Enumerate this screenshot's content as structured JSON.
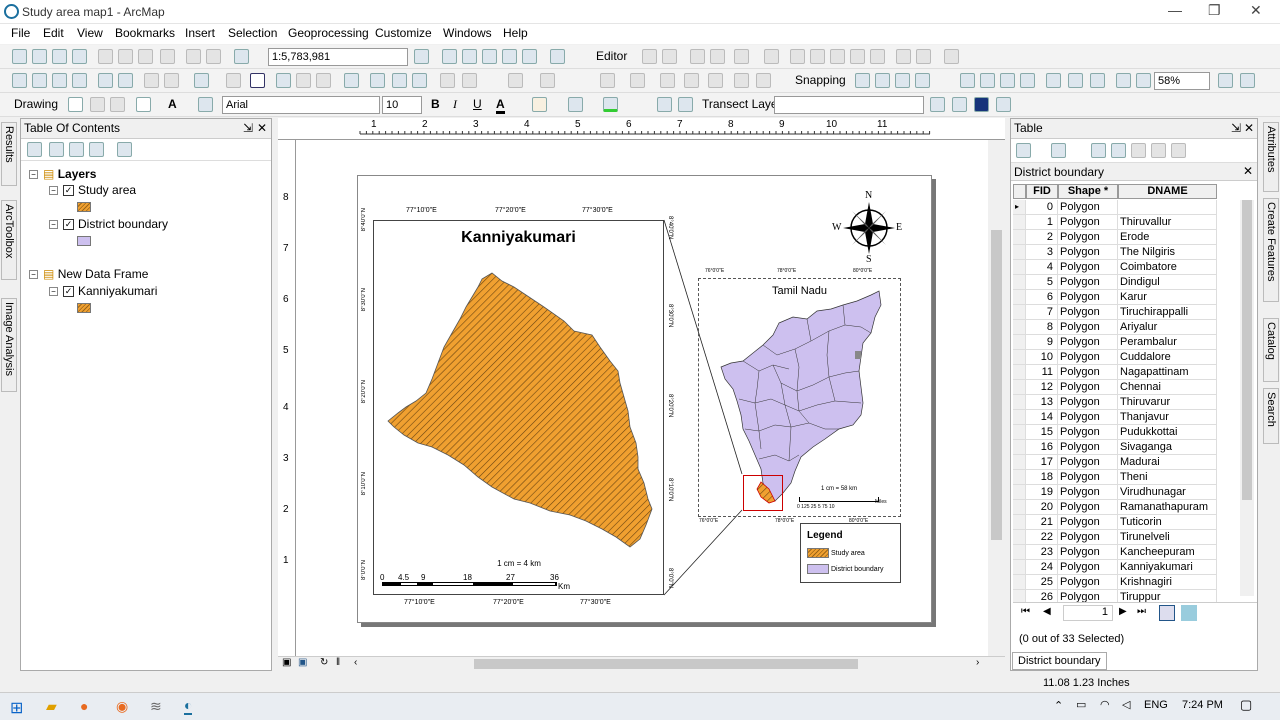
{
  "window": {
    "title": "Study area map1 - ArcMap"
  },
  "menu": [
    "File",
    "Edit",
    "View",
    "Bookmarks",
    "Insert",
    "Selection",
    "Geoprocessing",
    "Customize",
    "Windows",
    "Help"
  ],
  "toolbar": {
    "scale": "1:5,783,981",
    "editor": "Editor",
    "snapping": "Snapping",
    "zoom": "58%",
    "drawing": "Drawing",
    "font": "Arial",
    "font_size": "10",
    "bold": "B",
    "italic": "I",
    "underline": "U",
    "text_tool": "A",
    "transect": "Transect Layer"
  },
  "toc": {
    "title": "Table Of Contents",
    "layers": "Layers",
    "study_area": "Study area",
    "district_boundary": "District boundary",
    "new_frame": "New Data Frame",
    "kanniyakumari": "Kanniyakumari"
  },
  "side_left": [
    "Results",
    "ArcToolbox",
    "Image Analysis"
  ],
  "side_right": [
    "Attributes",
    "Create Features",
    "Catalog",
    "Search"
  ],
  "map": {
    "title": "Kanniyakumari",
    "top_ticks": [
      "77°10'0\"E",
      "77°20'0\"E",
      "77°30'0\"E"
    ],
    "bottom_ticks": [
      "77°10'0\"E",
      "77°20'0\"E",
      "77°30'0\"E"
    ],
    "left_ticks": [
      "8°40'0\"N",
      "8°30'0\"N",
      "8°20'0\"N",
      "8°10'0\"N",
      "8°0'0\"N"
    ],
    "scale_text": "1 cm = 4 km",
    "scale_ticks": [
      "0",
      "4.5",
      "9",
      "18",
      "27",
      "36"
    ],
    "scale_unit": "Km",
    "inset_title": "Tamil Nadu",
    "inset_top": [
      "76°0'0\"E",
      "78°0'0\"E",
      "80°0'0\"E"
    ],
    "inset_bottom": [
      "76°0'0\"E",
      "78°0'0\"E",
      "80°0'0\"E"
    ],
    "inset_scale": "1 cm = 58 km",
    "inset_scale_ticks": "0 125 25 5 75 10",
    "inset_unit": "Miles",
    "legend_title": "Legend",
    "legend_items": [
      "Study area",
      "District boundary"
    ],
    "compass": {
      "n": "N",
      "s": "S",
      "e": "E",
      "w": "W"
    },
    "ruler_top": [
      "1",
      "2",
      "3",
      "4",
      "5",
      "6",
      "7",
      "8",
      "9",
      "10",
      "11"
    ],
    "ruler_left": [
      "8",
      "7",
      "6",
      "5",
      "4",
      "3",
      "2",
      "1"
    ]
  },
  "table": {
    "title": "Table",
    "layer": "District boundary",
    "cols": [
      "FID",
      "Shape *",
      "DNAME"
    ],
    "rows": [
      [
        "0",
        "Polygon",
        ""
      ],
      [
        "1",
        "Polygon",
        "Thiruvallur"
      ],
      [
        "2",
        "Polygon",
        "Erode"
      ],
      [
        "3",
        "Polygon",
        "The Nilgiris"
      ],
      [
        "4",
        "Polygon",
        "Coimbatore"
      ],
      [
        "5",
        "Polygon",
        "Dindigul"
      ],
      [
        "6",
        "Polygon",
        "Karur"
      ],
      [
        "7",
        "Polygon",
        "Tiruchirappalli"
      ],
      [
        "8",
        "Polygon",
        "Ariyalur"
      ],
      [
        "9",
        "Polygon",
        "Perambalur"
      ],
      [
        "10",
        "Polygon",
        "Cuddalore"
      ],
      [
        "11",
        "Polygon",
        "Nagapattinam"
      ],
      [
        "12",
        "Polygon",
        "Chennai"
      ],
      [
        "13",
        "Polygon",
        "Thiruvarur"
      ],
      [
        "14",
        "Polygon",
        "Thanjavur"
      ],
      [
        "15",
        "Polygon",
        "Pudukkottai"
      ],
      [
        "16",
        "Polygon",
        "Sivaganga"
      ],
      [
        "17",
        "Polygon",
        "Madurai"
      ],
      [
        "18",
        "Polygon",
        "Theni"
      ],
      [
        "19",
        "Polygon",
        "Virudhunagar"
      ],
      [
        "20",
        "Polygon",
        "Ramanathapuram"
      ],
      [
        "21",
        "Polygon",
        "Tuticorin"
      ],
      [
        "22",
        "Polygon",
        "Tirunelveli"
      ],
      [
        "23",
        "Polygon",
        "Kancheepuram"
      ],
      [
        "24",
        "Polygon",
        "Kanniyakumari"
      ],
      [
        "25",
        "Polygon",
        "Krishnagiri"
      ],
      [
        "26",
        "Polygon",
        "Tiruppur"
      ]
    ],
    "record": "1",
    "selected": "(0 out of 33 Selected)",
    "tab": "District boundary"
  },
  "status": {
    "coords": "11.08  1.23 Inches"
  },
  "taskbar": {
    "lang": "ENG",
    "time": "7:24 PM"
  }
}
